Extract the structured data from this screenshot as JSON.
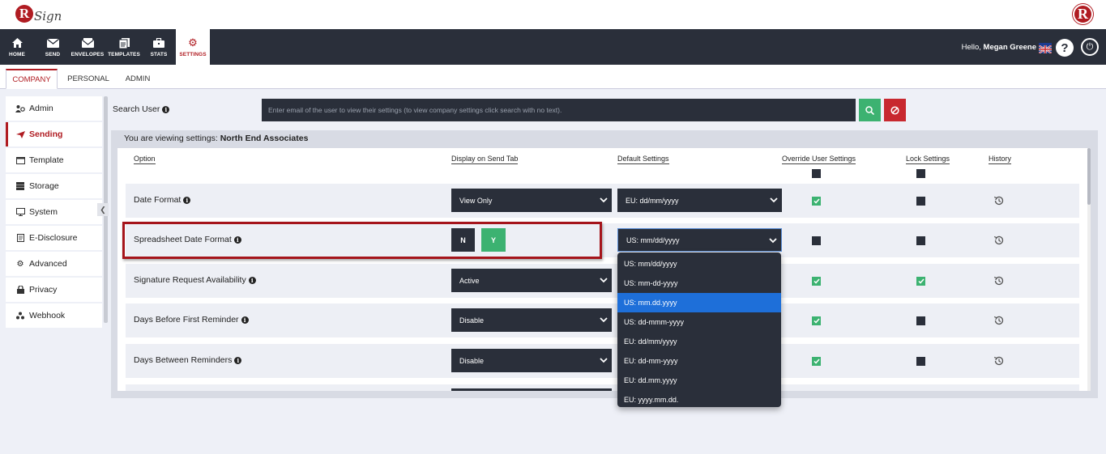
{
  "brand": {
    "logo_letter": "R",
    "logo_text": "Sign"
  },
  "nav": {
    "items": [
      {
        "label": "HOME",
        "icon": "home-icon"
      },
      {
        "label": "SEND",
        "icon": "envelope-icon"
      },
      {
        "label": "ENVELOPES",
        "icon": "envelopes-icon"
      },
      {
        "label": "TEMPLATES",
        "icon": "templates-icon"
      },
      {
        "label": "STATS",
        "icon": "briefcase-icon"
      },
      {
        "label": "SETTINGS",
        "icon": "gear-icon"
      }
    ],
    "active": "SETTINGS",
    "greeting": "Hello,",
    "user_name": "Megan Greene",
    "help_symbol": "?"
  },
  "subtabs": {
    "items": [
      "COMPANY",
      "PERSONAL",
      "ADMIN"
    ],
    "active": "COMPANY"
  },
  "sidebar": {
    "items": [
      "Admin",
      "Sending",
      "Template",
      "Storage",
      "System",
      "E-Disclosure",
      "Advanced",
      "Privacy",
      "Webhook"
    ],
    "active": "Sending"
  },
  "search": {
    "label": "Search User",
    "placeholder": "Enter email of the user to view their settings (to view company settings click search with no text)."
  },
  "viewing": {
    "prefix": "You are viewing settings:",
    "company": "North End Associates"
  },
  "columns": {
    "option": "Option",
    "display": "Display on Send Tab",
    "default": "Default Settings",
    "override": "Override User Settings",
    "lock": "Lock Settings",
    "history": "History"
  },
  "rows": [
    {
      "label": "Date Format",
      "display": "View Only",
      "default": "EU: dd/mm/yyyy",
      "override": true,
      "lock": false
    },
    {
      "label": "Spreadsheet Date Format",
      "display_n": "N",
      "display_y": "Y",
      "default": "US: mm/dd/yyyy",
      "override": false,
      "lock": false
    },
    {
      "label": "Signature Request Availability",
      "display": "Active",
      "override": true,
      "lock": true
    },
    {
      "label": "Days Before First Reminder",
      "display": "Disable",
      "override": true,
      "lock": false
    },
    {
      "label": "Days Between Reminders",
      "display": "Disable",
      "override": true,
      "lock": false
    }
  ],
  "dropdown": {
    "options": [
      "US: mm/dd/yyyy",
      "US: mm-dd-yyyy",
      "US: mm.dd.yyyy",
      "US: dd-mmm-yyyy",
      "EU: dd/mm/yyyy",
      "EU: dd-mm-yyyy",
      "EU: dd.mm.yyyy",
      "EU: yyyy.mm.dd."
    ],
    "highlighted": "US: mm.dd.yyyy"
  },
  "colors": {
    "brand_red": "#b01c22",
    "nav_dark": "#2a2f3a",
    "success_green": "#3cb271",
    "danger_red": "#c8282f",
    "select_blue": "#1e6fd9"
  }
}
